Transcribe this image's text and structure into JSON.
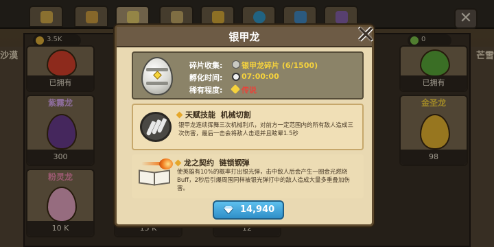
{
  "background": {
    "resources": [
      "3.5K",
      "0"
    ],
    "side_labels": [
      "沙漠",
      "芒雪"
    ],
    "cards": [
      {
        "name": "",
        "status": "已拥有",
        "egg_color": "#d9412b"
      },
      {
        "name": "",
        "status": "已拥有",
        "egg_color": "#5aa93a"
      },
      {
        "name": "紫霧龙",
        "price": "300",
        "egg_color": "#6b3d8f"
      },
      {
        "name": "金圣龙",
        "price": "98",
        "egg_color": "#e8b531"
      },
      {
        "name": "粉灵龙",
        "price": "10 K",
        "egg_color": "#e6a6c4"
      },
      {
        "name": "",
        "price": "15 K",
        "egg_color": "#7c6a50"
      },
      {
        "name": "",
        "price": "12",
        "egg_color": "#7c6a50"
      }
    ],
    "close_label": "✕"
  },
  "modal": {
    "title": "银甲龙",
    "close_label": "✕",
    "info": {
      "shard_label": "碎片收集:",
      "shard_value": "银甲龙碎片 (6/1500)",
      "hatch_label": "孵化时间:",
      "hatch_value": "07:00:00",
      "rarity_label": "稀有程度:",
      "rarity_value": "传说"
    },
    "talent": {
      "tag": "天赋技能",
      "name": "机械切割",
      "description": "银甲龙连续挥舞三次机械利爪，对前方一定范围内的所有敌人造成三次伤害，最后一击会将敌人击退并且眩晕1.5秒"
    },
    "contract": {
      "tag": "龙之契约",
      "name": "链锁钢弹",
      "description": "使英雄有10%的概率打出银光弹，击中敌人后会产生一圈金光燃烧Buff，2秒后引爆周围同样被银光弹打中的敌人造成大量多重叠加伤害。"
    },
    "buy_price": "14,940"
  }
}
